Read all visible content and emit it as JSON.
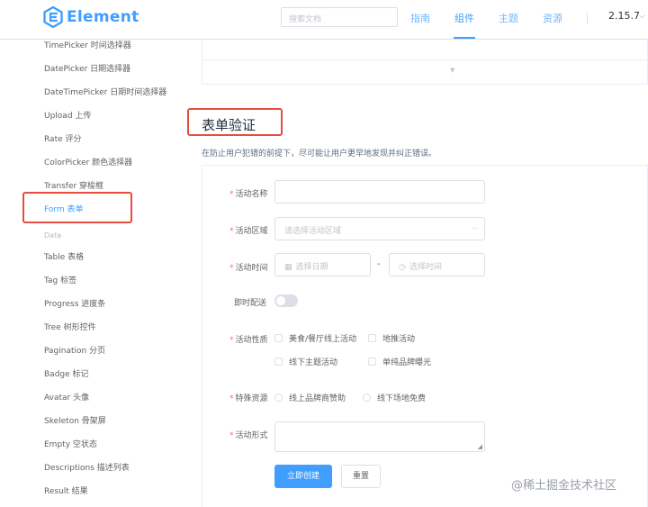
{
  "header": {
    "logo_text": "Element",
    "search_placeholder": "搜索文档",
    "nav": [
      "指南",
      "组件",
      "主题",
      "资源"
    ],
    "active_nav": "组件",
    "version": "2.15.7"
  },
  "sidebar": {
    "items": [
      "TimePicker 时间选择器",
      "DatePicker 日期选择器",
      "DateTimePicker 日期时间选择器",
      "Upload 上传",
      "Rate 评分",
      "ColorPicker 颜色选择器",
      "Transfer 穿梭框",
      "Form 表单"
    ],
    "group_label": "Data",
    "data_items": [
      "Table 表格",
      "Tag 标签",
      "Progress 进度条",
      "Tree 树形控件",
      "Pagination 分页",
      "Badge 标记",
      "Avatar 头像",
      "Skeleton 骨架屏",
      "Empty 空状态",
      "Descriptions 描述列表",
      "Result 结果"
    ],
    "active_item": "Form 表单"
  },
  "main": {
    "section_title": "表单验证",
    "section_desc": "在防止用户犯错的前提下，尽可能让用户更早地发现并纠正错误。"
  },
  "form": {
    "required_mark": "*",
    "name_label": "活动名称",
    "region_label": "活动区域",
    "region_placeholder": "请选择活动区域",
    "time_label": "活动时间",
    "date_placeholder": "选择日期",
    "time_placeholder": "选择时间",
    "range_sep": "-",
    "delivery_label": "即时配送",
    "type_label": "活动性质",
    "type_options": [
      "美食/餐厅线上活动",
      "地推活动",
      "线下主题活动",
      "单纯品牌曝光"
    ],
    "resource_label": "特殊资源",
    "resource_options": [
      "线上品牌商赞助",
      "线下场地免费"
    ],
    "desc_label": "活动形式",
    "submit_label": "立即创建",
    "reset_label": "重置"
  },
  "watermark": "@稀土掘金技术社区",
  "colors": {
    "primary": "#409eff",
    "danger": "#f56c6c",
    "annotation": "#e84c3d"
  }
}
